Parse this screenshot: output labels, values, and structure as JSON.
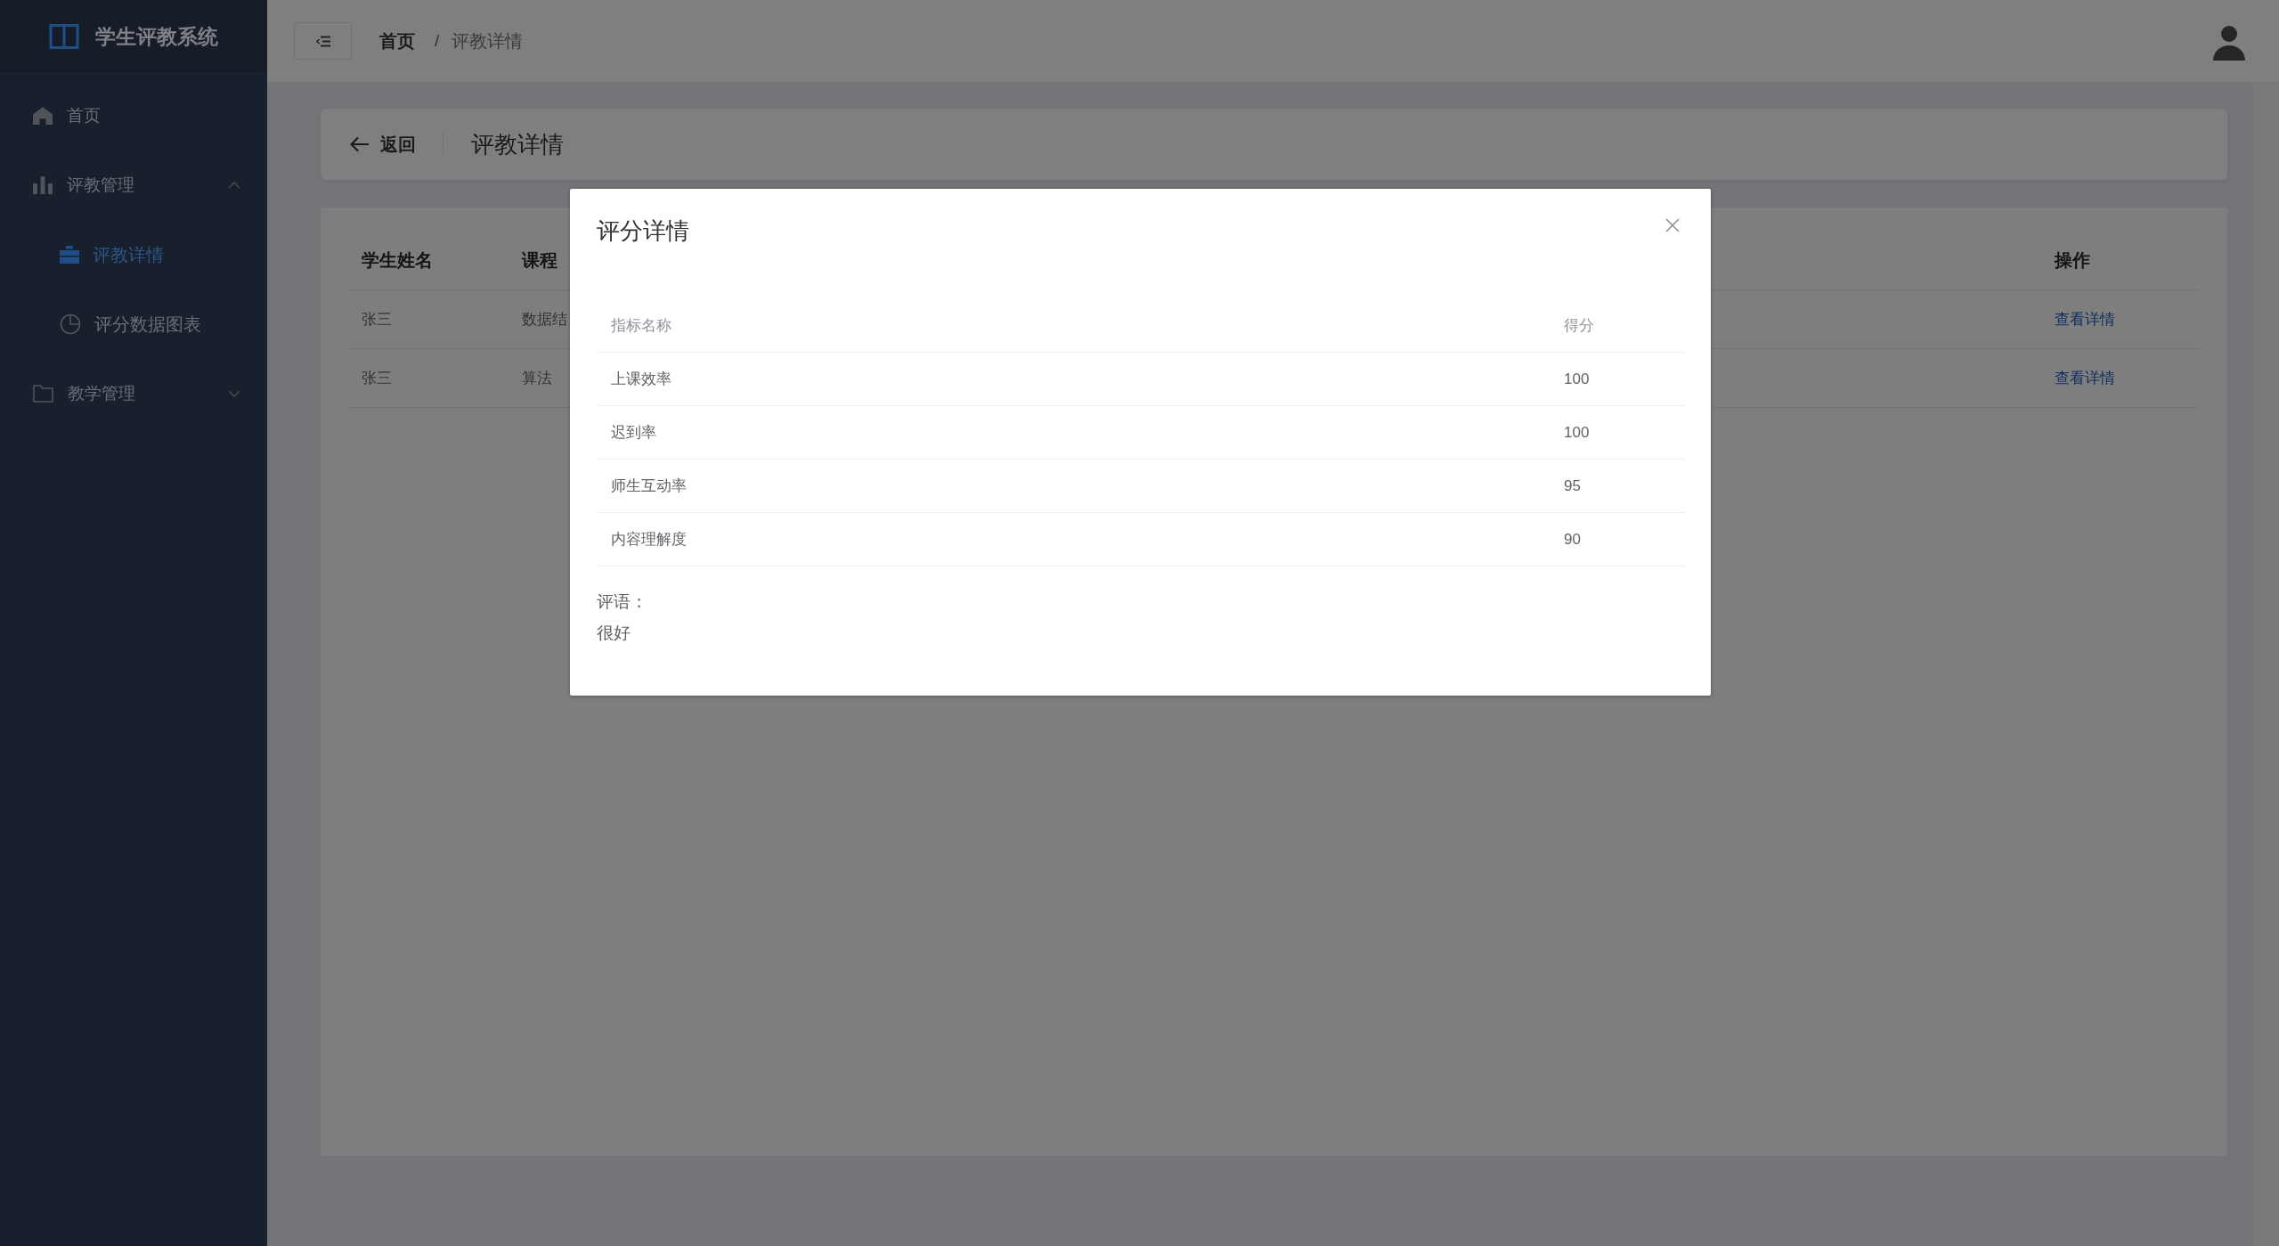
{
  "sidebar": {
    "title": "学生评教系统",
    "items": [
      {
        "label": "首页",
        "selected": false
      },
      {
        "label": "评教管理",
        "selected": false,
        "expanded": true,
        "children": [
          {
            "label": "评教详情",
            "selected": true
          },
          {
            "label": "评分数据图表",
            "selected": false
          }
        ]
      },
      {
        "label": "教学管理",
        "selected": false,
        "expanded": false
      }
    ]
  },
  "header": {
    "breadcrumb": {
      "items": [
        "首页",
        "评教详情"
      ],
      "separator": "/"
    }
  },
  "page_header": {
    "back": "返回",
    "title": "评教详情"
  },
  "table": {
    "columns": [
      {
        "label": "学生姓名",
        "kind": "text"
      },
      {
        "label": "课程",
        "kind": "text"
      },
      {
        "label": "操作",
        "kind": "action"
      }
    ],
    "rows": [
      [
        "张三",
        "数据结",
        "查看详情"
      ],
      [
        "张三",
        "算法",
        "查看详情"
      ]
    ]
  },
  "dialog": {
    "title": "评分详情",
    "columns": [
      "指标名称",
      "得分"
    ],
    "rows": [
      {
        "name": "上课效率",
        "score": "100"
      },
      {
        "name": "迟到率",
        "score": "100"
      },
      {
        "name": "师生互动率",
        "score": "95"
      },
      {
        "name": "内容理解度",
        "score": "90"
      }
    ],
    "comment_label": "评语：",
    "comment": "很好"
  }
}
